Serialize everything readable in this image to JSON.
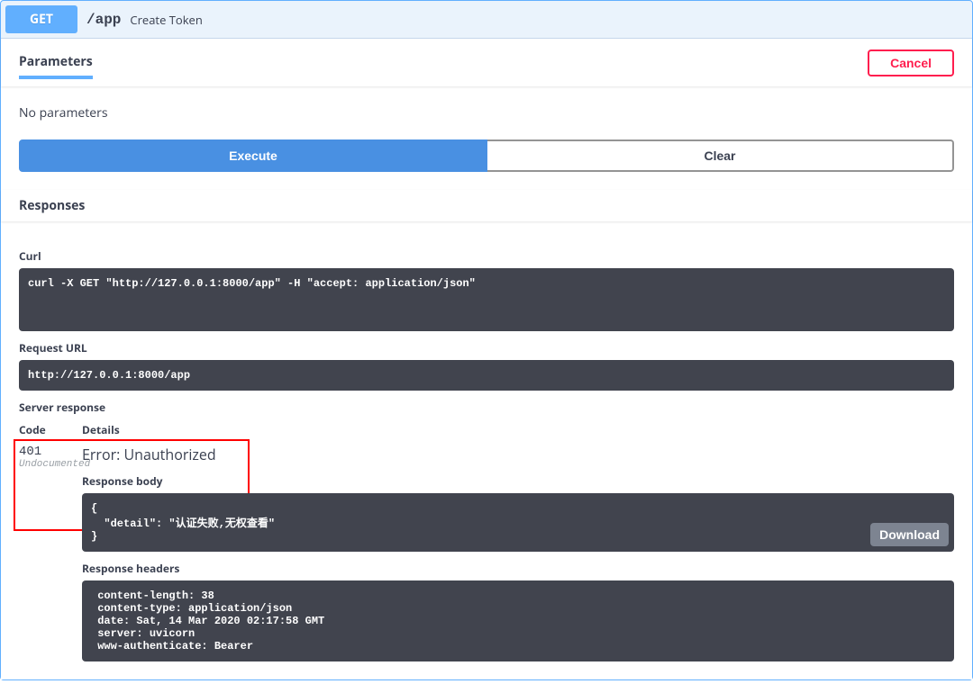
{
  "summary": {
    "method": "GET",
    "path": "/app",
    "title": "Create Token"
  },
  "tabs": {
    "parameters": "Parameters"
  },
  "buttons": {
    "cancel": "Cancel",
    "execute": "Execute",
    "clear": "Clear",
    "download": "Download"
  },
  "params": {
    "none": "No parameters"
  },
  "responses_label": "Responses",
  "curl": {
    "label": "Curl",
    "cmd": "curl -X GET \"http://127.0.0.1:8000/app\" -H \"accept: application/json\""
  },
  "request_url": {
    "label": "Request URL",
    "value": "http://127.0.0.1:8000/app"
  },
  "server_response": {
    "label": "Server response",
    "code_header": "Code",
    "details_header": "Details",
    "code": "401",
    "undocumented": "Undocumented",
    "error": "Error: Unauthorized",
    "body_label": "Response body",
    "body": "{\n  \"detail\": \"认证失败,无权查看\"\n}",
    "headers_label": "Response headers",
    "headers": " content-length: 38 \n content-type: application/json \n date: Sat, 14 Mar 2020 02:17:58 GMT \n server: uvicorn \n www-authenticate: Bearer "
  }
}
